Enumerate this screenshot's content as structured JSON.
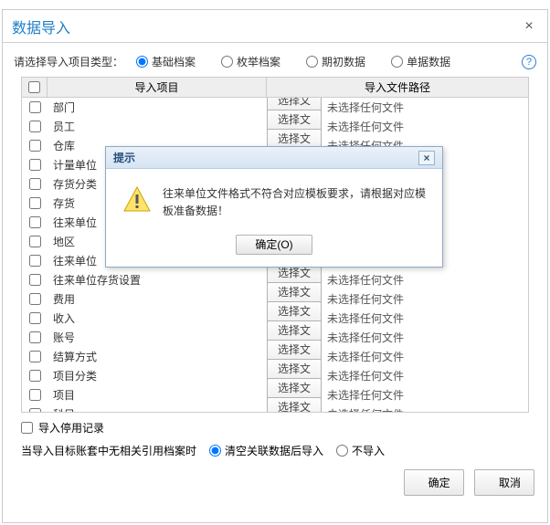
{
  "dialog": {
    "title": "数据导入",
    "close": "×"
  },
  "option_label": "请选择导入项目类型：",
  "radios": {
    "basic": "基础档案",
    "enum": "枚举档案",
    "initial": "期初数据",
    "bill": "单据数据"
  },
  "headers": {
    "item": "导入项目",
    "path": "导入文件路径"
  },
  "pick_label": "选择文件",
  "no_file": "未选择任何文件",
  "rows": [
    {
      "name": "部门"
    },
    {
      "name": "员工"
    },
    {
      "name": "仓库"
    },
    {
      "name": "计量单位"
    },
    {
      "name": "存货分类"
    },
    {
      "name": "存货"
    },
    {
      "name": "往来单位"
    },
    {
      "name": "地区"
    },
    {
      "name": "往来单位"
    },
    {
      "name": "往来单位存货设置"
    },
    {
      "name": "费用"
    },
    {
      "name": "收入"
    },
    {
      "name": "账号"
    },
    {
      "name": "结算方式"
    },
    {
      "name": "项目分类"
    },
    {
      "name": "项目"
    },
    {
      "name": "科目"
    }
  ],
  "stopped_label": "导入停用记录",
  "missing_ref_label": "当导入目标账套中无相关引用档案时",
  "missing_ref_opts": {
    "clear": "清空关联数据后导入",
    "skip": "不导入"
  },
  "footer": {
    "ok": "确定",
    "cancel": "取消"
  },
  "modal": {
    "title": "提示",
    "close": "×",
    "message": "往来单位文件格式不符合对应模板要求，请根据对应模板准备数据！",
    "ok": "确定(O)"
  }
}
